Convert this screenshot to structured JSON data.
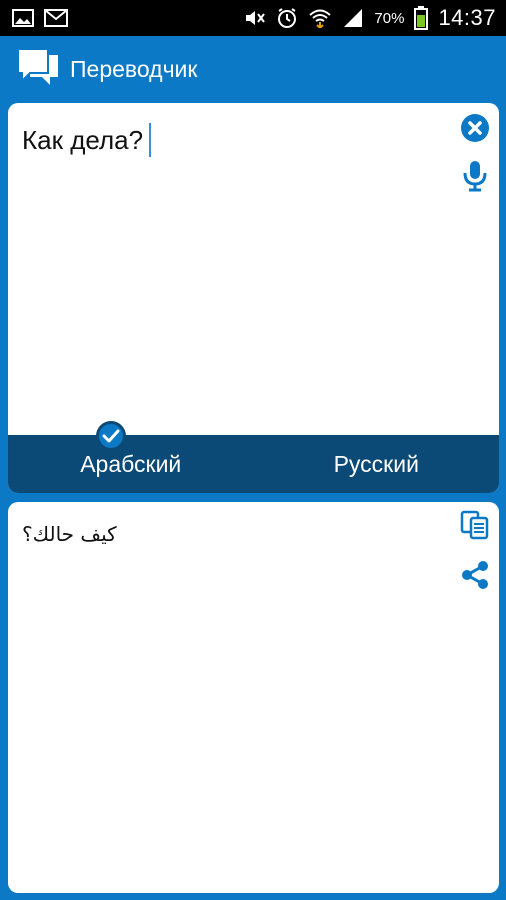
{
  "status_bar": {
    "battery_percent": "70%",
    "time": "14:37",
    "icons_left": [
      "image-icon",
      "mail-icon"
    ],
    "icons_right": [
      "mute-icon",
      "alarm-icon",
      "wifi-icon",
      "signal-icon",
      "battery-icon"
    ]
  },
  "app_bar": {
    "title": "Переводчик",
    "icon": "chat-bubbles-icon"
  },
  "input": {
    "text": "Как дела?",
    "actions": [
      "clear-icon",
      "microphone-icon"
    ]
  },
  "languages": {
    "source": "Арабский",
    "target": "Русский",
    "selected": "source"
  },
  "output": {
    "text": "كيف حالك؟",
    "actions": [
      "copy-icon",
      "share-icon"
    ]
  },
  "colors": {
    "primary": "#0b79c5",
    "dark": "#0b4a76",
    "card": "#ffffff"
  }
}
